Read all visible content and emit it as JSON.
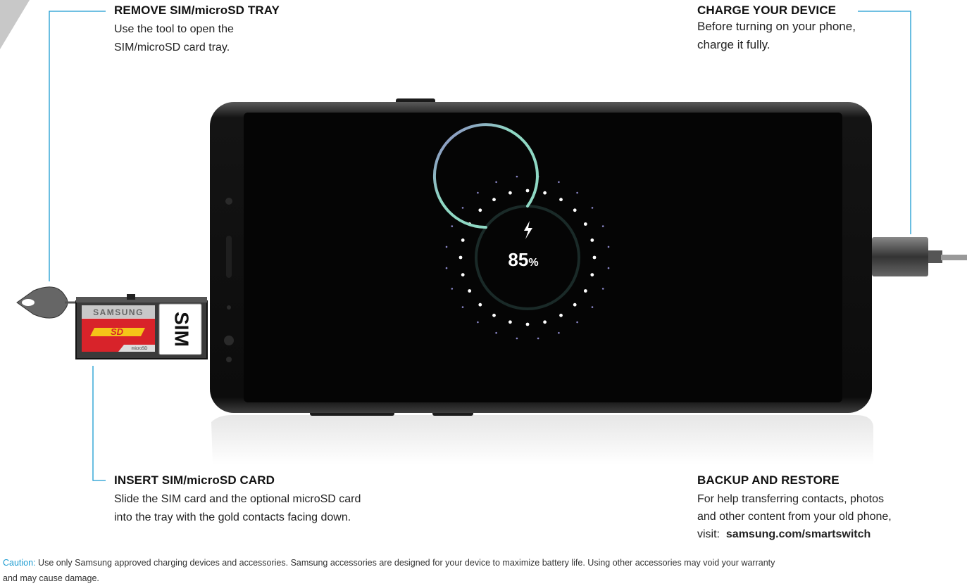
{
  "callouts": {
    "remove_tray": {
      "title": "REMOVE SIM/microSD TRAY",
      "body": [
        "Use the tool to open the",
        "SIM/microSD card tray."
      ]
    },
    "charge": {
      "title": "CHARGE YOUR DEVICE",
      "body": [
        "Before turning on your phone,",
        "charge it fully."
      ]
    },
    "insert_card": {
      "title": "INSERT SIM/microSD CARD",
      "body": [
        "Slide the SIM card and the optional microSD card",
        "into the tray with the gold contacts facing down."
      ]
    },
    "backup": {
      "title": "BACKUP AND RESTORE",
      "body": [
        "For help transferring contacts, photos",
        "and other content from your old phone,"
      ],
      "visit_label": "visit:",
      "link": "samsung.com/smartswitch"
    }
  },
  "phone_screen": {
    "battery_percent": "85",
    "percent_sign": "%",
    "charge_level": 0.85
  },
  "tray": {
    "brand_label": "SAMSUNG",
    "sd_label": "SD",
    "micro_label": "microSD",
    "sim_label": "SIM"
  },
  "caution": {
    "label": "Caution:",
    "line1": "Use only Samsung approved charging devices and accessories. Samsung accessories are designed for your device to maximize battery life. Using other accessories may void your warranty",
    "line2": "and may cause damage."
  },
  "colors": {
    "leader_line": "#1a9bd1",
    "charge_ring": "#8fd8c4",
    "ring_accent": "#8a7fc0",
    "sd_red": "#d8232a",
    "sd_yellow": "#f5c518"
  }
}
